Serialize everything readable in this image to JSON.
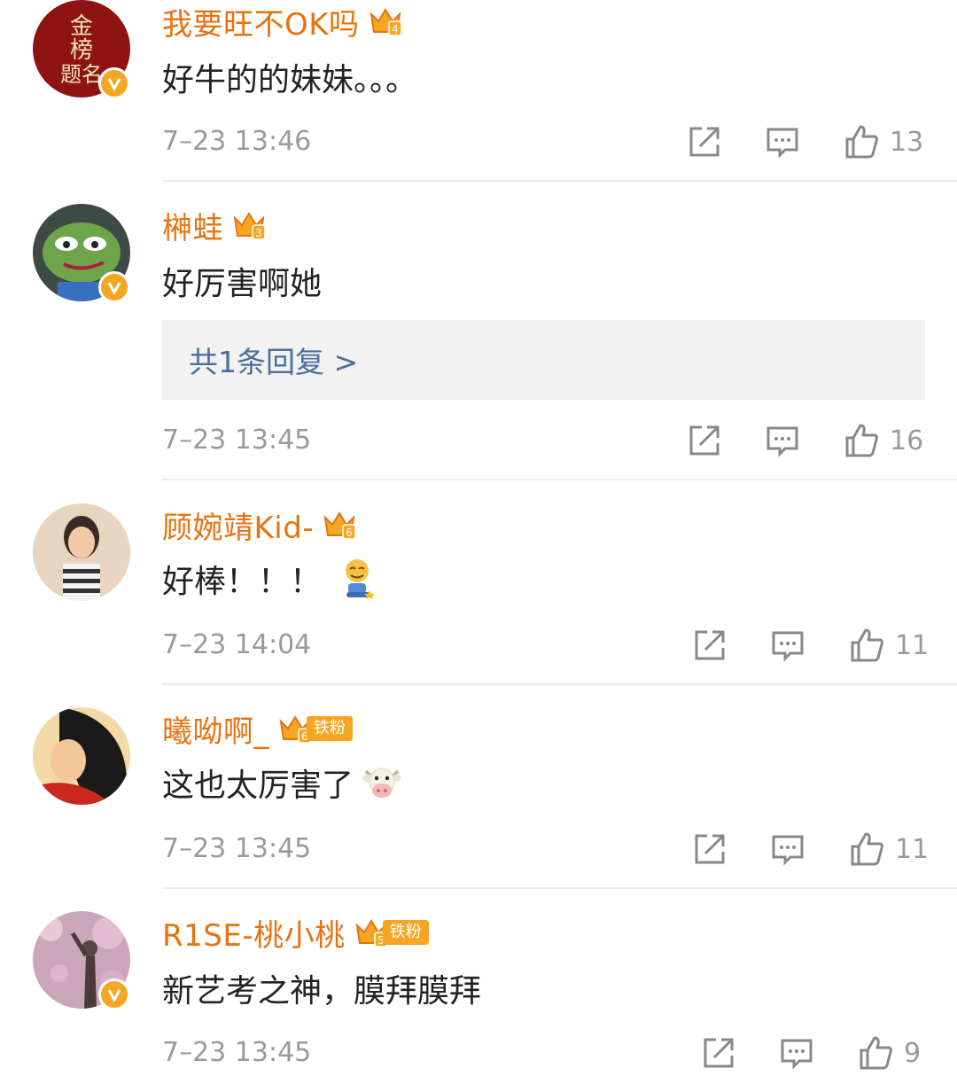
{
  "comments": [
    {
      "username": "我要旺不OK吗",
      "fan_level": "4",
      "text": "好牛的的妹妹。。。",
      "time": "7–23 13:46",
      "likes": "13",
      "verified": true
    },
    {
      "username": "榊蛙",
      "fan_level": "3",
      "text": "好厉害啊她",
      "reply_link": "共1条回复 >",
      "time": "7–23 13:45",
      "likes": "16",
      "verified": true
    },
    {
      "username": "顾婉靖Kid-",
      "fan_level": "6",
      "text": "好棒！！！",
      "emoji": "smile-kneeling-emoji",
      "time": "7–23 14:04",
      "likes": "11",
      "verified": false
    },
    {
      "username": "曦呦啊_",
      "fan_level": "6",
      "fan_badge": "铁粉",
      "text": "这也太厉害了",
      "emoji": "cow-face-emoji",
      "time": "7–23 13:45",
      "likes": "11",
      "verified": false
    },
    {
      "username": "R1SE-桃小桃",
      "fan_level": "5",
      "fan_badge": "铁粉",
      "text": "新艺考之神，膜拜膜拜",
      "time": "7–23 13:45",
      "likes": "9",
      "verified": true
    }
  ],
  "colors": {
    "username": "#e8720e",
    "badge": "#f5a623",
    "reply_link": "#4a6f9c",
    "meta": "#9a9a9a"
  },
  "icons": [
    "share-icon",
    "comment-icon",
    "like-icon",
    "crown-icon",
    "verified-icon"
  ]
}
